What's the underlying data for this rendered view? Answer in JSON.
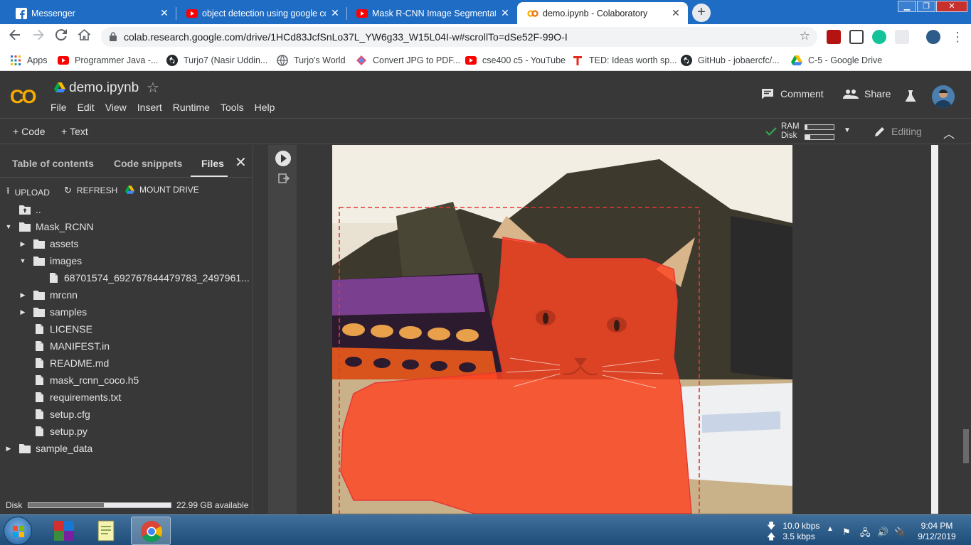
{
  "browser": {
    "tabs": [
      {
        "title": "Messenger",
        "icon": "facebook-icon"
      },
      {
        "title": "object detection using google co",
        "icon": "youtube-icon"
      },
      {
        "title": "Mask R-CNN Image Segmentatio",
        "icon": "youtube-icon"
      },
      {
        "title": "demo.ipynb - Colaboratory",
        "icon": "colab-icon",
        "active": true
      }
    ],
    "url": "colab.research.google.com/drive/1HCd83JcfSnLo37L_YW6g33_W15L04I-w#scrollTo=dSe52F-99O-I",
    "bookmarks": [
      {
        "label": "Apps",
        "icon": "apps-grid-icon"
      },
      {
        "label": "Programmer Java -...",
        "icon": "youtube-icon"
      },
      {
        "label": "Turjo7 (Nasir Uddin...",
        "icon": "github-icon"
      },
      {
        "label": "Turjo's World",
        "icon": "globe-icon"
      },
      {
        "label": "Convert JPG to PDF...",
        "icon": "pdf-convert-icon"
      },
      {
        "label": "cse400 c5 - YouTube",
        "icon": "youtube-icon"
      },
      {
        "label": "TED: Ideas worth sp...",
        "icon": "ted-icon"
      },
      {
        "label": "GitHub - jobaercfc/...",
        "icon": "github-icon"
      },
      {
        "label": "C-5 - Google Drive",
        "icon": "drive-icon"
      }
    ]
  },
  "colab": {
    "logo": "CO",
    "notebook_title": "demo.ipynb",
    "menu": [
      "File",
      "Edit",
      "View",
      "Insert",
      "Runtime",
      "Tools",
      "Help"
    ],
    "comment_label": "Comment",
    "share_label": "Share",
    "add_code_label": "Code",
    "add_text_label": "Text",
    "ram_label": "RAM",
    "disk_label": "Disk",
    "ram_usage": 0.08,
    "disk_usage": 0.18,
    "editing_label": "Editing"
  },
  "panel": {
    "tabs": [
      "Table of contents",
      "Code snippets",
      "Files"
    ],
    "active_tab": "Files",
    "actions": {
      "upload": "UPLOAD",
      "refresh": "REFRESH",
      "mount": "MOUNT DRIVE"
    },
    "tree": [
      {
        "name": "..",
        "type": "up",
        "depth": 0
      },
      {
        "name": "Mask_RCNN",
        "type": "folder",
        "depth": 0,
        "expanded": true
      },
      {
        "name": "assets",
        "type": "folder",
        "depth": 1,
        "expanded": false
      },
      {
        "name": "images",
        "type": "folder",
        "depth": 1,
        "expanded": true
      },
      {
        "name": "68701574_692767844479783_2497961...",
        "type": "file",
        "depth": 2
      },
      {
        "name": "mrcnn",
        "type": "folder",
        "depth": 1,
        "expanded": false
      },
      {
        "name": "samples",
        "type": "folder",
        "depth": 1,
        "expanded": false
      },
      {
        "name": "LICENSE",
        "type": "file",
        "depth": 1
      },
      {
        "name": "MANIFEST.in",
        "type": "file",
        "depth": 1
      },
      {
        "name": "README.md",
        "type": "file",
        "depth": 1
      },
      {
        "name": "mask_rcnn_coco.h5",
        "type": "file",
        "depth": 1
      },
      {
        "name": "requirements.txt",
        "type": "file",
        "depth": 1
      },
      {
        "name": "setup.cfg",
        "type": "file",
        "depth": 1
      },
      {
        "name": "setup.py",
        "type": "file",
        "depth": 1
      },
      {
        "name": "sample_data",
        "type": "folder",
        "depth": 0,
        "expanded": false
      }
    ],
    "disk_label": "Disk",
    "disk_used_fraction": 0.53,
    "disk_available": "22.99 GB available"
  },
  "output": {
    "mask_color": "#ff4422",
    "box_color": "#e53935"
  },
  "taskbar": {
    "net_down": "10.0 kbps",
    "net_up": "3.5 kbps",
    "time": "9:04 PM",
    "date": "9/12/2019"
  }
}
